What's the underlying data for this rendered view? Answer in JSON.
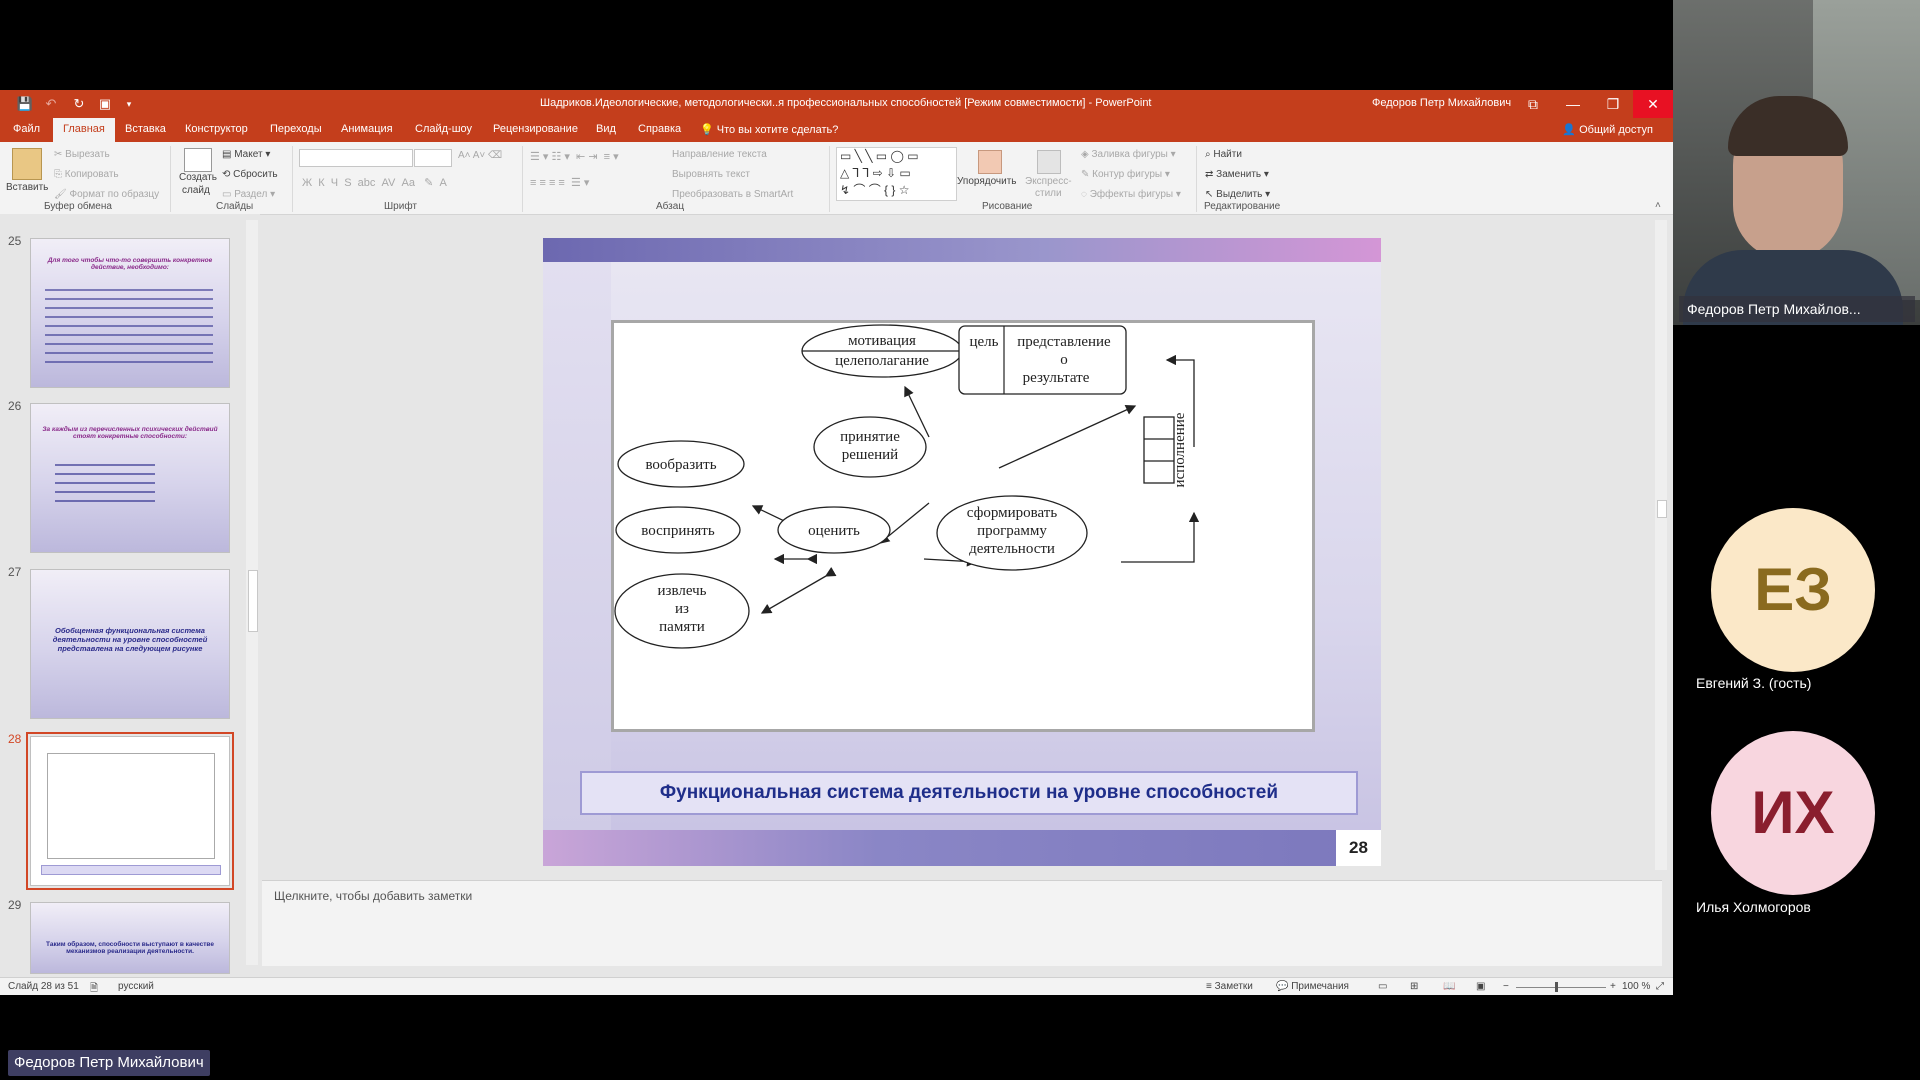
{
  "window": {
    "title": "Шадриков.Идеологические, методологически..я профессиональных способностей [Режим совместимости]  -  PowerPoint",
    "user": "Федоров Петр Михайлович"
  },
  "tabs": [
    "Файл",
    "Главная",
    "Вставка",
    "Конструктор",
    "Переходы",
    "Анимация",
    "Слайд-шоу",
    "Рецензирование",
    "Вид",
    "Справка"
  ],
  "tell_me": "Что вы хотите сделать?",
  "share": "Общий доступ",
  "ribbon": {
    "paste": "Вставить",
    "cut": "Вырезать",
    "copy": "Копировать",
    "format_painter": "Формат по образцу",
    "clipboard": "Буфер обмена",
    "new_slide_1": "Создать",
    "new_slide_2": "слайд",
    "layout": "Макет",
    "reset": "Сбросить",
    "section": "Раздел",
    "slides": "Слайды",
    "font_group": "Шрифт",
    "text_direction": "Направление текста",
    "align_text": "Выровнять текст",
    "smartart": "Преобразовать в SmartArt",
    "paragraph": "Абзац",
    "arrange": "Упорядочить",
    "quick_styles_1": "Экспресс-",
    "quick_styles_2": "стили",
    "shape_fill": "Заливка фигуры",
    "shape_outline": "Контур фигуры",
    "shape_effects": "Эффекты фигуры",
    "drawing": "Рисование",
    "find": "Найти",
    "replace": "Заменить",
    "select": "Выделить",
    "editing": "Редактирование"
  },
  "thumbnails": [
    {
      "num": "25",
      "text": "Для того чтобы что-то совершить конкретное действие, необходимо:"
    },
    {
      "num": "26",
      "text": "За каждым из перечисленных психических действий стоят конкретные способности:"
    },
    {
      "num": "27",
      "text": "Обобщенная функциональная система деятельности на уровне способностей представлена на следующем рисунке"
    },
    {
      "num": "28",
      "text": ""
    },
    {
      "num": "29",
      "text": "Таким образом, способности выступают в качестве механизмов реализации деятельности."
    }
  ],
  "slide": {
    "nodes": {
      "motivation_1": "мотивация",
      "motivation_2": "целеполагание",
      "goal": "цель",
      "rep_1": "представление",
      "rep_2": "о",
      "rep_3": "результате",
      "decision_1": "принятие",
      "decision_2": "решений",
      "imagine": "вообразить",
      "perceive": "воспринять",
      "evaluate": "оценить",
      "form_1": "сформировать",
      "form_2": "программу",
      "form_3": "деятельности",
      "recall_1": "извлечь",
      "recall_2": "из",
      "recall_3": "памяти",
      "execution": "исполнение"
    },
    "caption": "Функциональная система деятельности на уровне способностей",
    "number": "28"
  },
  "notes_placeholder": "Щелкните, чтобы добавить заметки",
  "status": {
    "slide": "Слайд 28 из 51",
    "language": "русский",
    "notes": "Заметки",
    "comments": "Примечания",
    "zoom": "100 %"
  },
  "participants": {
    "camera_name": "Федоров Петр Михайлов...",
    "p1_initials": "ЕЗ",
    "p1_name": "Евгений  З. (гость)",
    "p2_initials": "ИХ",
    "p2_name": "Илья Холмогоров"
  },
  "speaker": "Федоров Петр Михайлович",
  "colors": {
    "ppt_accent": "#c43e1c",
    "avatar1": "#fbe8c8",
    "avatar2": "#f8d6df",
    "caption_text": "#1f2e8a"
  }
}
